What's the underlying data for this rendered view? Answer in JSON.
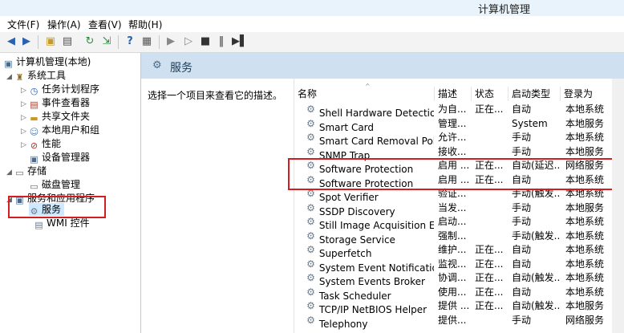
{
  "window": {
    "title": "计算机管理"
  },
  "menu": [
    "文件(F)",
    "操作(A)",
    "查看(V)",
    "帮助(H)"
  ],
  "toolbar_icons": [
    "back-icon",
    "forward-icon",
    "up-icon",
    "show-hide-tree-icon",
    "refresh-icon",
    "export-icon",
    "help-icon",
    "properties-icon",
    "play-icon",
    "play-alt-icon",
    "stop-icon",
    "pause-icon",
    "restart-icon"
  ],
  "tree": {
    "root": "计算机管理(本地)",
    "system_tools": "系统工具",
    "task_scheduler": "任务计划程序",
    "event_viewer": "事件查看器",
    "shared_folders": "共享文件夹",
    "local_users": "本地用户和组",
    "performance": "性能",
    "device_manager": "设备管理器",
    "storage": "存储",
    "disk_management": "磁盘管理",
    "services_apps": "服务和应用程序",
    "services": "服务",
    "wmi": "WMI 控件"
  },
  "header": {
    "title": "服务"
  },
  "description": {
    "text": "选择一个项目来查看它的描述。"
  },
  "columns": [
    "名称",
    "描述",
    "状态",
    "启动类型",
    "登录为"
  ],
  "services": [
    {
      "name": "Shell Hardware Detection",
      "desc": "为自...",
      "status": "正在...",
      "startup": "自动",
      "logon": "本地系统"
    },
    {
      "name": "Smart Card",
      "desc": "管理...",
      "status": "",
      "startup": "System",
      "logon": "本地服务"
    },
    {
      "name": "Smart Card Removal Poli...",
      "desc": "允许...",
      "status": "",
      "startup": "手动",
      "logon": "本地系统"
    },
    {
      "name": "SNMP Trap",
      "desc": "接收...",
      "status": "",
      "startup": "手动",
      "logon": "本地服务"
    },
    {
      "name": "Software Protection",
      "desc": "启用 ...",
      "status": "正在...",
      "startup": "自动(延迟...",
      "logon": "网络服务"
    },
    {
      "name": "Software Protection",
      "desc": "启用 ...",
      "status": "正在...",
      "startup": "自动",
      "logon": "本地系统"
    },
    {
      "name": "Spot Verifier",
      "desc": "验证...",
      "status": "",
      "startup": "手动(触发...",
      "logon": "本地系统"
    },
    {
      "name": "SSDP Discovery",
      "desc": "当发...",
      "status": "",
      "startup": "手动",
      "logon": "本地服务"
    },
    {
      "name": "Still Image Acquisition Ev...",
      "desc": "启动...",
      "status": "",
      "startup": "手动",
      "logon": "本地系统"
    },
    {
      "name": "Storage Service",
      "desc": "强制...",
      "status": "",
      "startup": "手动(触发...",
      "logon": "本地系统"
    },
    {
      "name": "Superfetch",
      "desc": "维护...",
      "status": "正在...",
      "startup": "自动",
      "logon": "本地系统"
    },
    {
      "name": "System Event Notification...",
      "desc": "监视...",
      "status": "正在...",
      "startup": "自动",
      "logon": "本地系统"
    },
    {
      "name": "System Events Broker",
      "desc": "协调...",
      "status": "正在...",
      "startup": "自动(触发...",
      "logon": "本地系统"
    },
    {
      "name": "Task Scheduler",
      "desc": "使用...",
      "status": "正在...",
      "startup": "自动",
      "logon": "本地系统"
    },
    {
      "name": "TCP/IP NetBIOS Helper",
      "desc": "提供 ...",
      "status": "正在...",
      "startup": "自动(触发...",
      "logon": "本地服务"
    },
    {
      "name": "Telephony",
      "desc": "提供...",
      "status": "",
      "startup": "手动",
      "logon": "网络服务"
    }
  ]
}
